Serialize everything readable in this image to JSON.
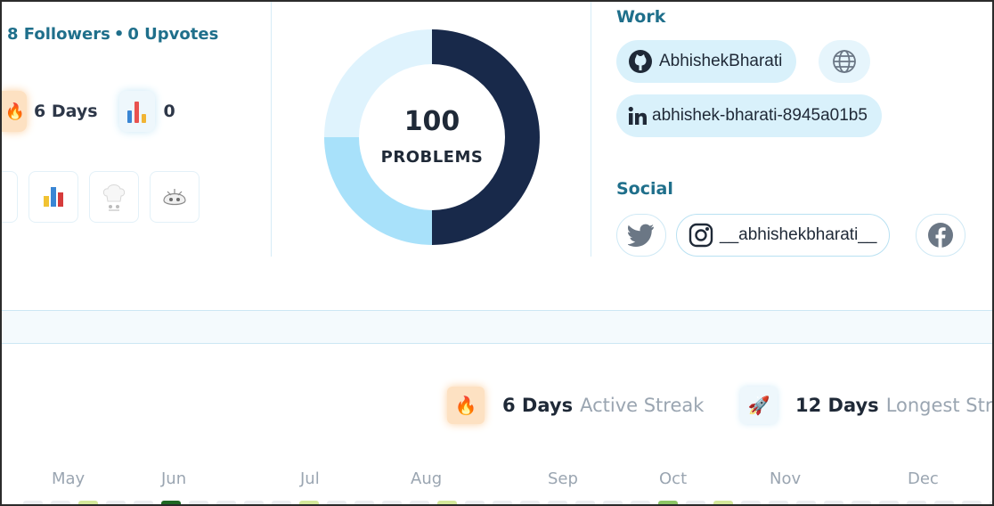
{
  "profile": {
    "followers_text": "8 Followers",
    "separator": "•",
    "upvotes_text": "0 Upvotes",
    "streak_days": "6 Days",
    "rank_value": "0"
  },
  "badges": [
    {
      "name": "badge-partial",
      "icon": "unknown"
    },
    {
      "name": "badge-bars",
      "icon": "bar-chart-icon"
    },
    {
      "name": "badge-chef",
      "icon": "chef-hat-icon"
    },
    {
      "name": "badge-mascot",
      "icon": "mascot-icon"
    }
  ],
  "problems": {
    "count": "100",
    "label": "PROBLEMS",
    "ring_segments": [
      0.5,
      0.25,
      0.25
    ],
    "ring_colors": [
      "#18294a",
      "#a8e1fa",
      "#dff3fd"
    ]
  },
  "work": {
    "title": "Work",
    "github": "AbhishekBharati",
    "linkedin": "abhishek-bharati-8945a01b5"
  },
  "social": {
    "title": "Social",
    "instagram": "__abhishekbharati__"
  },
  "streaks": {
    "active_value": "6 Days",
    "active_label": "Active Streak",
    "longest_value": "12 Days",
    "longest_label": "Longest Stre"
  },
  "calendar": {
    "months": [
      "May",
      "Jun",
      "Jul",
      "Aug",
      "Sep",
      "Oct",
      "Nov",
      "Dec"
    ]
  },
  "colors": {
    "accent": "#1f6f8b",
    "pill_bg": "#d9f1fb",
    "donut_dark": "#18294a",
    "donut_mid": "#a8e1fa",
    "donut_light": "#dff3fd"
  }
}
